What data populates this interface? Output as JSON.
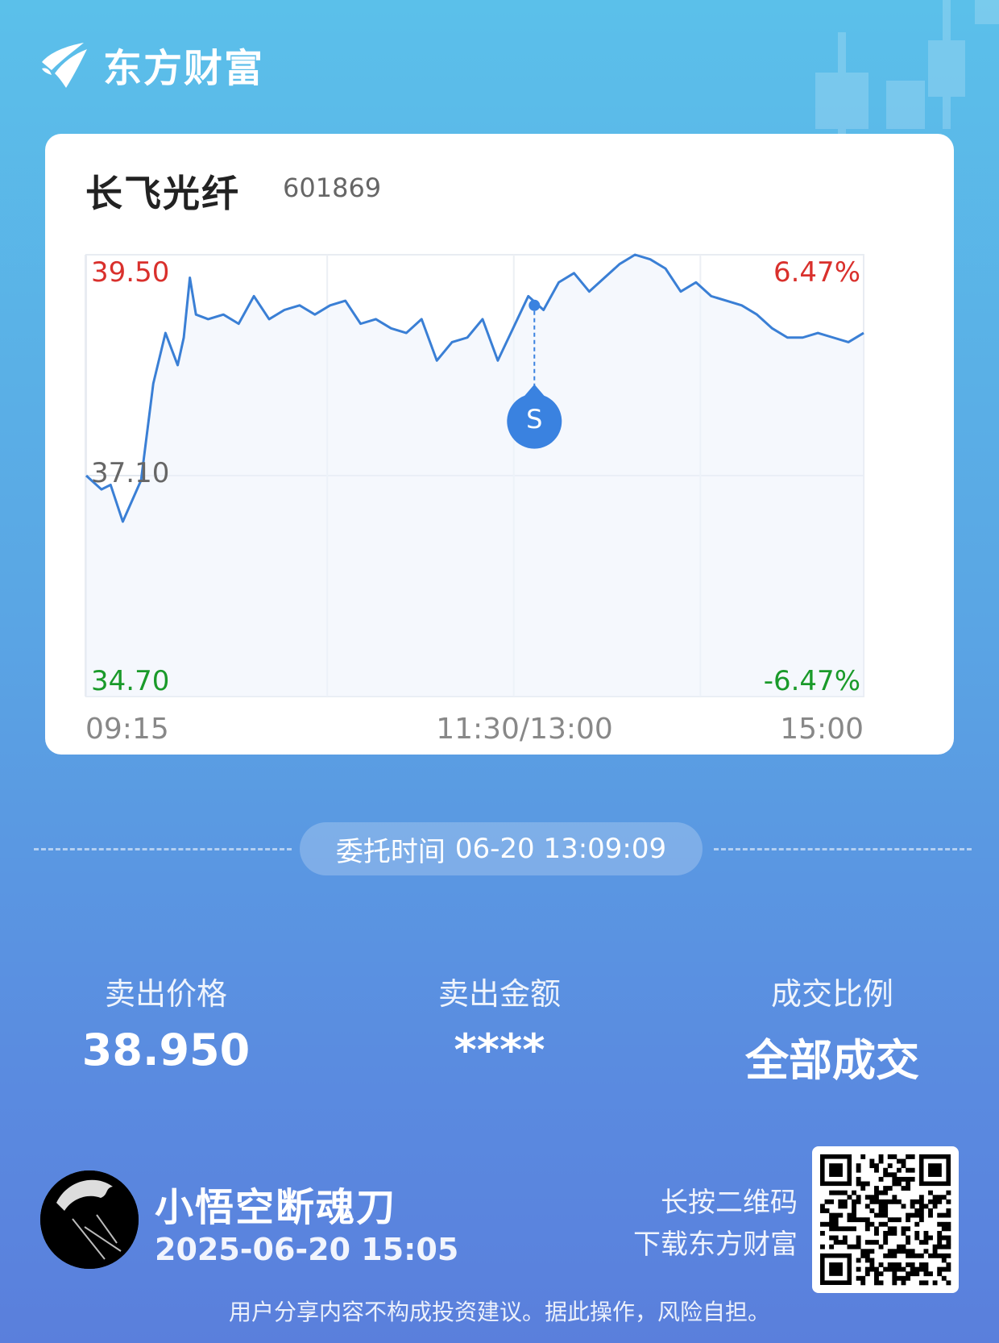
{
  "brand": {
    "name": "东方财富"
  },
  "stock": {
    "name": "长飞光纤",
    "code": "601869"
  },
  "chart_data": {
    "type": "line",
    "title": "",
    "price_labels": {
      "high": "39.50",
      "mid": "37.10",
      "low": "34.70"
    },
    "pct_labels": {
      "high": "6.47%",
      "low": "-6.47%"
    },
    "time_labels": [
      "09:15",
      "11:30/13:00",
      "15:00"
    ],
    "ylim": [
      34.7,
      39.5
    ],
    "reference_price": 37.1,
    "x_unit": "trading minutes from 09:15",
    "x": [
      0,
      5,
      8,
      12,
      18,
      22,
      26,
      30,
      32,
      34,
      36,
      40,
      45,
      50,
      55,
      60,
      65,
      70,
      75,
      80,
      85,
      90,
      95,
      100,
      105,
      110,
      115,
      120,
      125,
      130,
      135,
      140,
      145,
      150,
      155,
      160,
      165,
      170,
      175,
      180,
      185,
      190,
      195,
      200,
      205,
      210,
      215,
      220,
      225,
      230,
      235,
      240,
      245,
      250,
      255
    ],
    "values": [
      37.1,
      36.95,
      37.0,
      36.6,
      37.05,
      38.1,
      38.65,
      38.3,
      38.6,
      39.25,
      38.85,
      38.8,
      38.85,
      38.75,
      39.05,
      38.8,
      38.9,
      38.95,
      38.85,
      38.95,
      39.0,
      38.75,
      38.8,
      38.7,
      38.65,
      38.8,
      38.35,
      38.55,
      38.6,
      38.8,
      38.35,
      38.7,
      39.05,
      38.9,
      39.2,
      39.3,
      39.1,
      39.25,
      39.4,
      39.5,
      39.45,
      39.35,
      39.1,
      39.2,
      39.05,
      39.0,
      38.95,
      38.85,
      38.7,
      38.6,
      38.6,
      38.65,
      38.6,
      38.55,
      38.65
    ],
    "marker": {
      "label": "S",
      "x": 147,
      "value": 38.95
    }
  },
  "order": {
    "time_label": "委托时间",
    "time_value": "06-20 13:09:09"
  },
  "stats": [
    {
      "label": "卖出价格",
      "value": "38.950"
    },
    {
      "label": "卖出金额",
      "value": "****"
    },
    {
      "label": "成交比例",
      "value": "全部成交"
    }
  ],
  "user": {
    "name": "小悟空断魂刀",
    "time": "2025-06-20 15:05"
  },
  "qr_hint": {
    "line1": "长按二维码",
    "line2": "下载东方财富"
  },
  "disclaimer": "用户分享内容不构成投资建议。据此操作，风险自担。",
  "colors": {
    "up": "#d9302c",
    "down": "#1a9a2a",
    "line": "#3a7fd5",
    "accent": "#3a82e0"
  }
}
